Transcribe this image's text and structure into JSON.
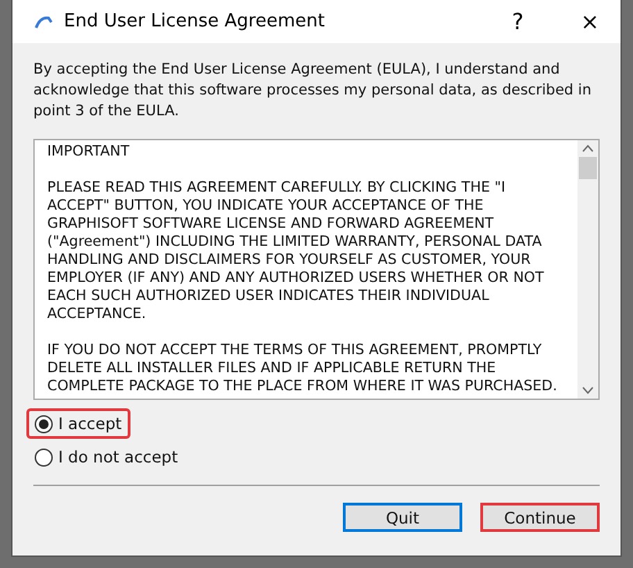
{
  "window": {
    "title": "End User License Agreement",
    "help": "?",
    "close": "×"
  },
  "intro": "By accepting the End User License Agreement (EULA), I understand and acknowledge that this software processes my personal data, as described in point 3 of the EULA.",
  "license_text": [
    "IMPORTANT",
    "PLEASE READ THIS AGREEMENT CAREFULLY. BY CLICKING THE \"I ACCEPT\" BUTTON, YOU INDICATE YOUR ACCEPTANCE OF THE GRAPHISOFT SOFTWARE LICENSE AND FORWARD AGREEMENT (\"Agreement\") INCLUDING THE LIMITED WARRANTY, PERSONAL DATA HANDLING AND DISCLAIMERS FOR YOURSELF AS CUSTOMER, YOUR EMPLOYER (IF ANY) AND ANY AUTHORIZED USERS WHETHER OR NOT EACH SUCH AUTHORIZED USER INDICATES THEIR INDIVIDUAL ACCEPTANCE.",
    "IF YOU DO NOT ACCEPT THE TERMS OF THIS AGREEMENT, PROMPTLY DELETE ALL INSTALLER FILES AND IF APPLICABLE RETURN THE COMPLETE PACKAGE TO THE PLACE FROM WHERE IT WAS PURCHASED."
  ],
  "options": [
    {
      "label": "I accept",
      "selected": true,
      "highlighted": true
    },
    {
      "label": "I do not accept",
      "selected": false,
      "highlighted": false
    }
  ],
  "buttons": [
    {
      "label": "Quit",
      "focused": true,
      "highlighted": false
    },
    {
      "label": "Continue",
      "focused": false,
      "highlighted": true
    }
  ]
}
